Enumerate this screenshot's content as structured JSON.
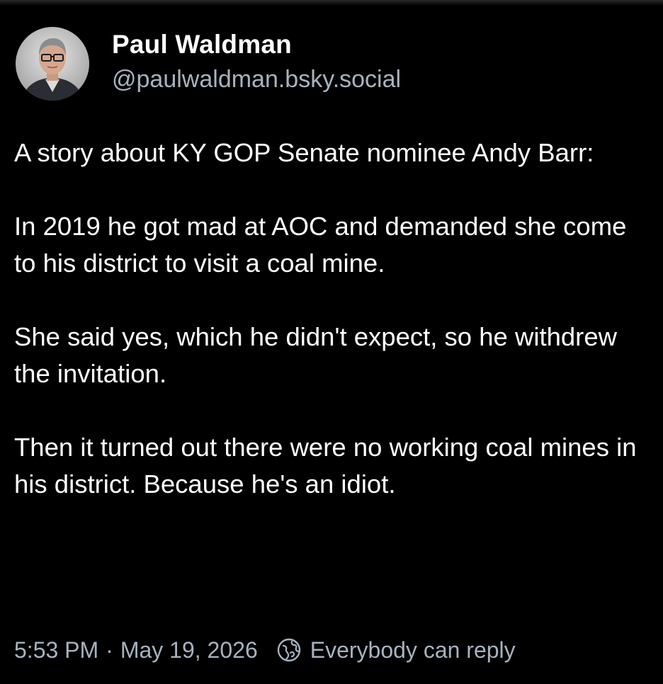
{
  "post": {
    "author": {
      "display_name": "Paul Waldman",
      "handle": "@paulwaldman.bsky.social",
      "avatar_icon": "avatar-photo"
    },
    "text": {
      "paragraphs": [
        "A story about KY GOP Senate nominee Andy Barr:",
        "In 2019 he got mad at AOC and demanded she come to his district to visit a coal mine.",
        "She said yes, which he didn't expect, so he withdrew the invitation.",
        "Then it turned out there were no working coal mines in his district. Because he's an idiot."
      ]
    },
    "meta": {
      "time": "5:53 PM",
      "separator": "·",
      "date": "May 19, 2026",
      "reply_icon": "globe-reply-icon",
      "reply_setting": "Everybody can reply"
    }
  },
  "colors": {
    "background": "#000000",
    "text_primary": "#ffffff",
    "text_secondary": "#a7b2bf"
  }
}
